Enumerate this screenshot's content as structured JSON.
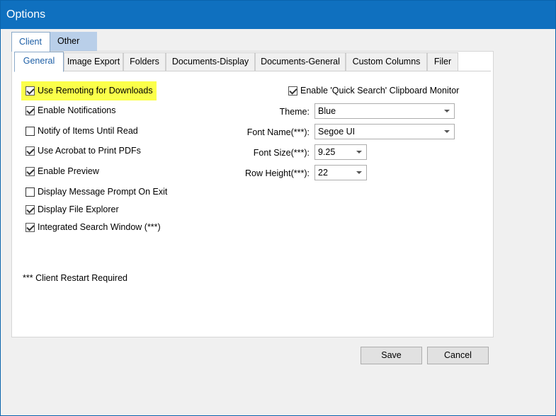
{
  "window": {
    "title": "Options"
  },
  "outer_tabs": [
    {
      "label": "Client"
    },
    {
      "label": "Other"
    }
  ],
  "inner_tabs": [
    {
      "label": "General"
    },
    {
      "label": "Image Export"
    },
    {
      "label": "Folders"
    },
    {
      "label": "Documents-Display"
    },
    {
      "label": "Documents-General"
    },
    {
      "label": "Custom Columns"
    },
    {
      "label": "Filer"
    }
  ],
  "checkboxes": [
    {
      "label": "Use Remoting for Downloads",
      "checked": true,
      "highlighted": true
    },
    {
      "label": "Enable Notifications",
      "checked": true
    },
    {
      "label": "Notify of Items Until Read",
      "checked": false
    },
    {
      "label": "Use Acrobat to Print PDFs",
      "checked": true
    },
    {
      "label": "Enable Preview",
      "checked": true
    },
    {
      "label": "Display Message Prompt On Exit",
      "checked": false
    },
    {
      "label": "Display File Explorer",
      "checked": true
    },
    {
      "label": "Integrated Search Window (***)",
      "checked": true
    }
  ],
  "quick_search": {
    "label": "Enable 'Quick Search' Clipboard Monitor",
    "checked": true
  },
  "fields": {
    "theme": {
      "label": "Theme:",
      "value": "Blue"
    },
    "font_name": {
      "label": "Font Name(***):",
      "value": "Segoe UI"
    },
    "font_size": {
      "label": "Font Size(***):",
      "value": "9.25"
    },
    "row_height": {
      "label": "Row Height(***):",
      "value": "22"
    }
  },
  "note": "*** Client Restart Required",
  "buttons": {
    "save": "Save",
    "cancel": "Cancel"
  },
  "colors": {
    "titlebar": "#0f70bf",
    "highlight": "#fbff4a",
    "active_tab_text": "#1d5fa6",
    "inactive_outer_tab": "#b9cfe9"
  }
}
